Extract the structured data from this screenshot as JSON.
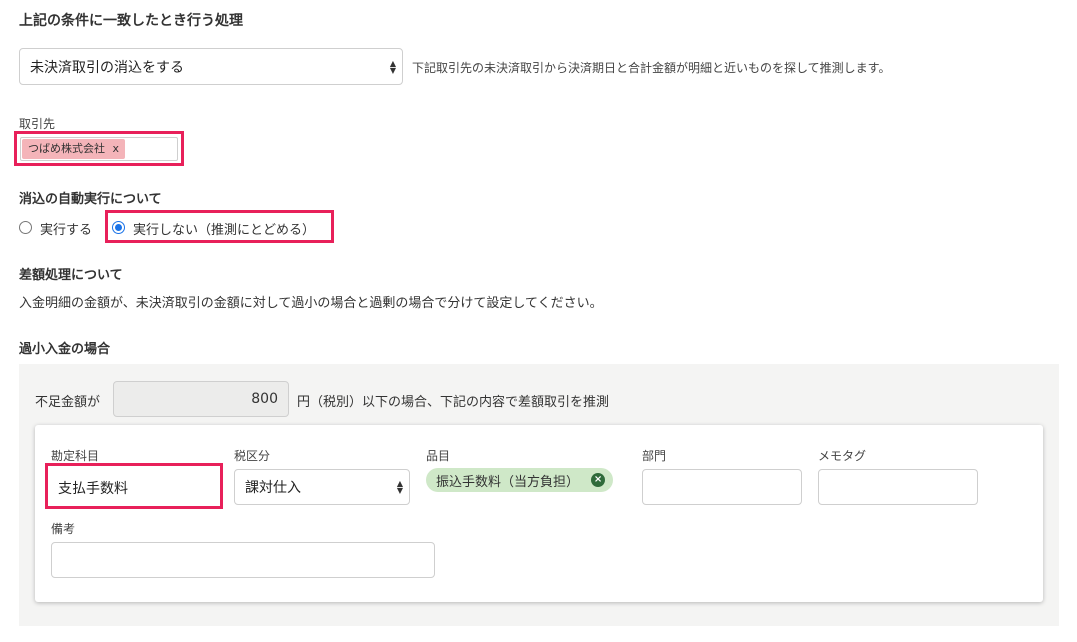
{
  "section_title": "上記の条件に一致したとき行う処理",
  "action_select": {
    "value": "未決済取引の消込をする"
  },
  "action_help": "下記取引先の未決済取引から決済期日と合計金額が明細と近いものを探して推測します。",
  "partner": {
    "label": "取引先",
    "tag": "つばめ株式会社",
    "tag_remove": "x"
  },
  "auto_exec": {
    "heading": "消込の自動実行について",
    "options": [
      "実行する",
      "実行しない（推測にとどめる）"
    ],
    "selected_index": 1
  },
  "difference": {
    "heading": "差額処理について",
    "description": "入金明細の金額が、未決済取引の金額に対して過小の場合と過剰の場合で分けて設定してください。"
  },
  "underpayment": {
    "heading": "過小入金の場合",
    "shortage_label": "不足金額が",
    "shortage_value": "800",
    "shortage_suffix": "円（税別）以下の場合、下記の内容で差額取引を推測",
    "fields": {
      "account_label": "勘定科目",
      "account_value": "支払手数料",
      "tax_label": "税区分",
      "tax_value": "課対仕入",
      "item_label": "品目",
      "item_value": "振込手数料（当方負担）",
      "department_label": "部門",
      "memo_tag_label": "メモタグ",
      "note_label": "備考"
    }
  },
  "colors": {
    "highlight": "#e8205a",
    "tag_bg": "#f4b4b9",
    "pill_bg": "#cfe8c8",
    "radio_accent": "#1a73e8",
    "panel_bg": "#f4f4f3"
  }
}
